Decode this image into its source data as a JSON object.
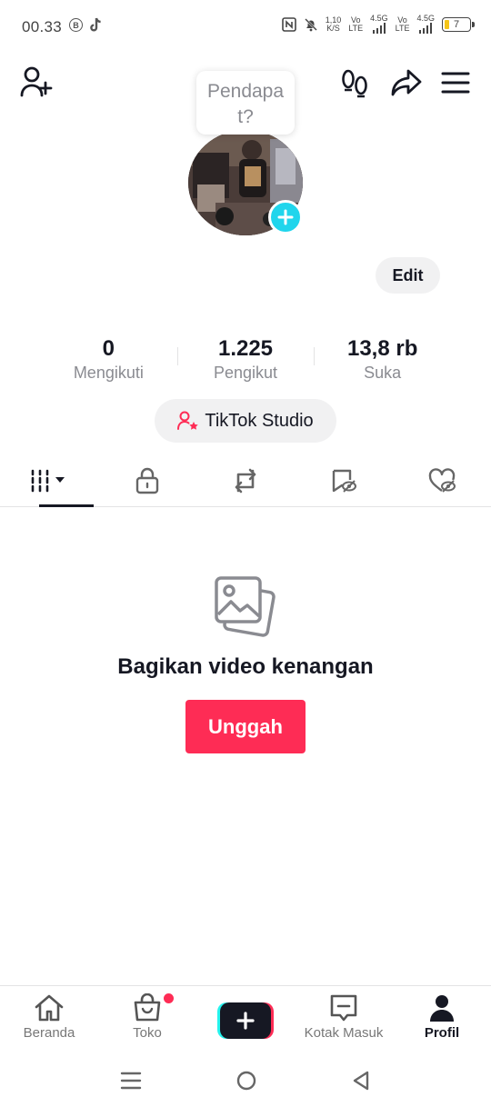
{
  "status_bar": {
    "time": "00.33",
    "b_icon": "B",
    "speed_value": "1,10",
    "speed_unit": "K/S",
    "sim1_top": "Vo",
    "sim1_bottom": "LTE",
    "sim1_net": "4.5G",
    "sim2_top": "Vo",
    "sim2_bottom": "LTE",
    "sim2_net": "4.5G",
    "battery": "7"
  },
  "tooltip": {
    "text": "Pendapat?"
  },
  "profile": {
    "edit_label": "Edit"
  },
  "stats": [
    {
      "value": "0",
      "label": "Mengikuti"
    },
    {
      "value": "1.225",
      "label": "Pengikut"
    },
    {
      "value": "13,8 rb",
      "label": "Suka"
    }
  ],
  "studio": {
    "label": "TikTok Studio"
  },
  "empty_state": {
    "title": "Bagikan video kenangan",
    "button": "Unggah"
  },
  "bottom_nav": {
    "home": "Beranda",
    "shop": "Toko",
    "inbox": "Kotak Masuk",
    "profile": "Profil"
  },
  "colors": {
    "accent": "#fe2c55",
    "cyan": "#25f4ee",
    "text": "#161823",
    "muted": "#8a8b91"
  }
}
